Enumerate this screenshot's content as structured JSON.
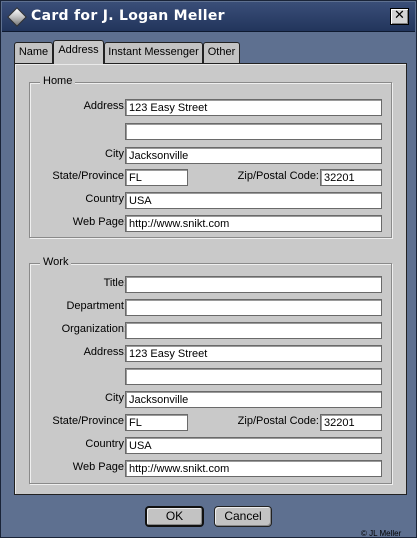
{
  "window": {
    "title": "Card for J. Logan Meller",
    "close_glyph": "✕",
    "icon": "address-card-diamond-icon"
  },
  "tabs": [
    {
      "label": "Name",
      "active": false
    },
    {
      "label": "Address",
      "active": true
    },
    {
      "label": "Instant Messenger",
      "active": false
    },
    {
      "label": "Other",
      "active": false
    }
  ],
  "home": {
    "title": "Home",
    "address_label": "Address:",
    "address_line1": "123 Easy Street",
    "address_line2": "",
    "city_label": "City:",
    "city": "Jacksonville",
    "state_label": "State/Province:",
    "state": "FL",
    "zip_label": "Zip/Postal Code:",
    "zip": "32201",
    "country_label": "Country:",
    "country": "USA",
    "webpage_label": "Web Page:",
    "webpage": "http://www.snikt.com"
  },
  "work": {
    "title": "Work",
    "title_label": "Title:",
    "title_value": "",
    "department_label": "Department:",
    "department": "",
    "organization_label": "Organization:",
    "organization": "",
    "address_label": "Address:",
    "address_line1": "123 Easy Street",
    "address_line2": "",
    "city_label": "City:",
    "city": "Jacksonville",
    "state_label": "State/Province:",
    "state": "FL",
    "zip_label": "Zip/Postal Code:",
    "zip": "32201",
    "country_label": "Country:",
    "country": "USA",
    "webpage_label": "Web Page:",
    "webpage": "http://www.snikt.com"
  },
  "buttons": {
    "ok": "OK",
    "cancel": "Cancel"
  },
  "footer": {
    "copyright": "© JL Meller"
  },
  "colors": {
    "window_background": "#5e7090",
    "titlebar": "#2b3f68",
    "panel": "#c9c9c9"
  }
}
